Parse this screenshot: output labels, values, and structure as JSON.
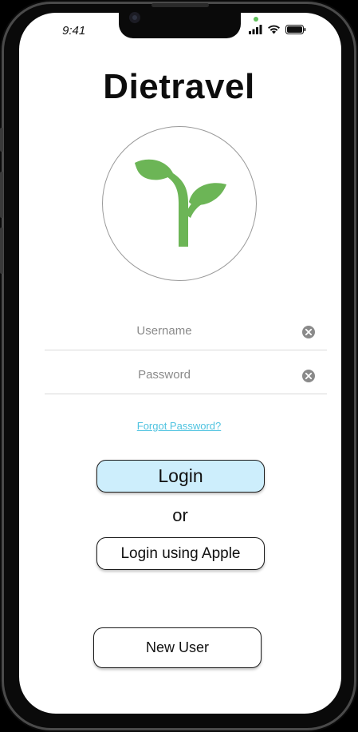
{
  "status_bar": {
    "time": "9:41",
    "icons": [
      "signal-icon",
      "wifi-icon",
      "battery-icon"
    ]
  },
  "app": {
    "title": "Dietravel",
    "logo_icon": "sprout-icon",
    "colors": {
      "sprout": "#6cb556",
      "login_button": "#cdeefc",
      "link": "#4fc3e0"
    }
  },
  "form": {
    "username": {
      "value": "",
      "placeholder": "Username"
    },
    "password": {
      "value": "",
      "placeholder": "Password"
    },
    "forgot_password": "Forgot Password?"
  },
  "actions": {
    "login_label": "Login",
    "or_label": "or",
    "apple_label": "Login using Apple",
    "new_user_label": "New User"
  }
}
